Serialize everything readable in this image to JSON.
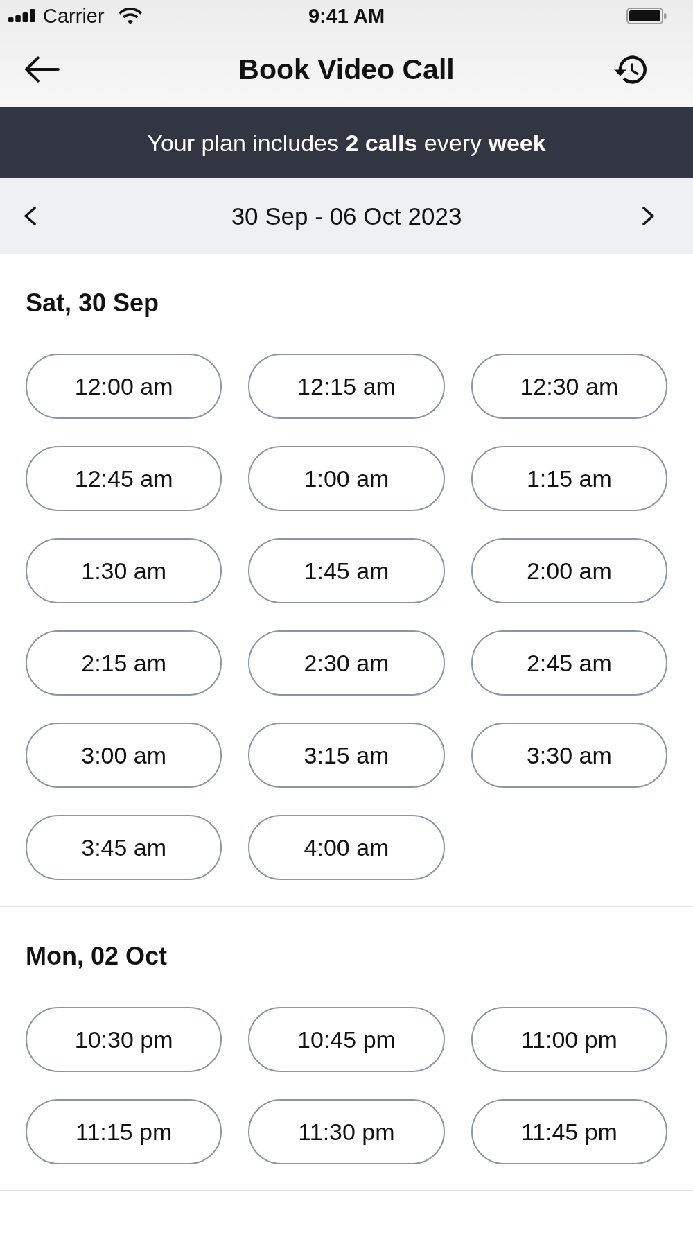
{
  "status_bar": {
    "carrier": "Carrier",
    "time": "9:41 AM"
  },
  "nav": {
    "title": "Book Video Call"
  },
  "banner": {
    "text": "Your plan includes **2 calls** every **week**"
  },
  "week_selector": {
    "range": "30 Sep - 06 Oct 2023"
  },
  "days": [
    {
      "heading": "Sat, 30 Sep",
      "slots": [
        {
          "time": "12:00 am",
          "selected": false
        },
        {
          "time": "12:15 am",
          "selected": false
        },
        {
          "time": "12:30 am",
          "selected": false
        },
        {
          "time": "12:45 am",
          "selected": false
        },
        {
          "time": "1:00 am",
          "selected": false
        },
        {
          "time": "1:15 am",
          "selected": false
        },
        {
          "time": "1:30 am",
          "selected": false
        },
        {
          "time": "1:45 am",
          "selected": false
        },
        {
          "time": "2:00 am",
          "selected": false
        },
        {
          "time": "2:15 am",
          "selected": false
        },
        {
          "time": "2:30 am",
          "selected": false
        },
        {
          "time": "2:45 am",
          "selected": false
        },
        {
          "time": "3:00 am",
          "selected": false
        },
        {
          "time": "3:15 am",
          "selected": false
        },
        {
          "time": "3:30 am",
          "selected": false
        },
        {
          "time": "3:45 am",
          "selected": false
        },
        {
          "time": "4:00 am",
          "selected": false
        }
      ]
    },
    {
      "heading": "Mon, 02 Oct",
      "slots": [
        {
          "time": "10:30 pm",
          "selected": false
        },
        {
          "time": "10:45 pm",
          "selected": false
        },
        {
          "time": "11:00 pm",
          "selected": false
        },
        {
          "time": "11:15 pm",
          "selected": false
        },
        {
          "time": "11:30 pm",
          "selected": false
        },
        {
          "time": "11:45 pm",
          "selected": false
        }
      ]
    }
  ]
}
